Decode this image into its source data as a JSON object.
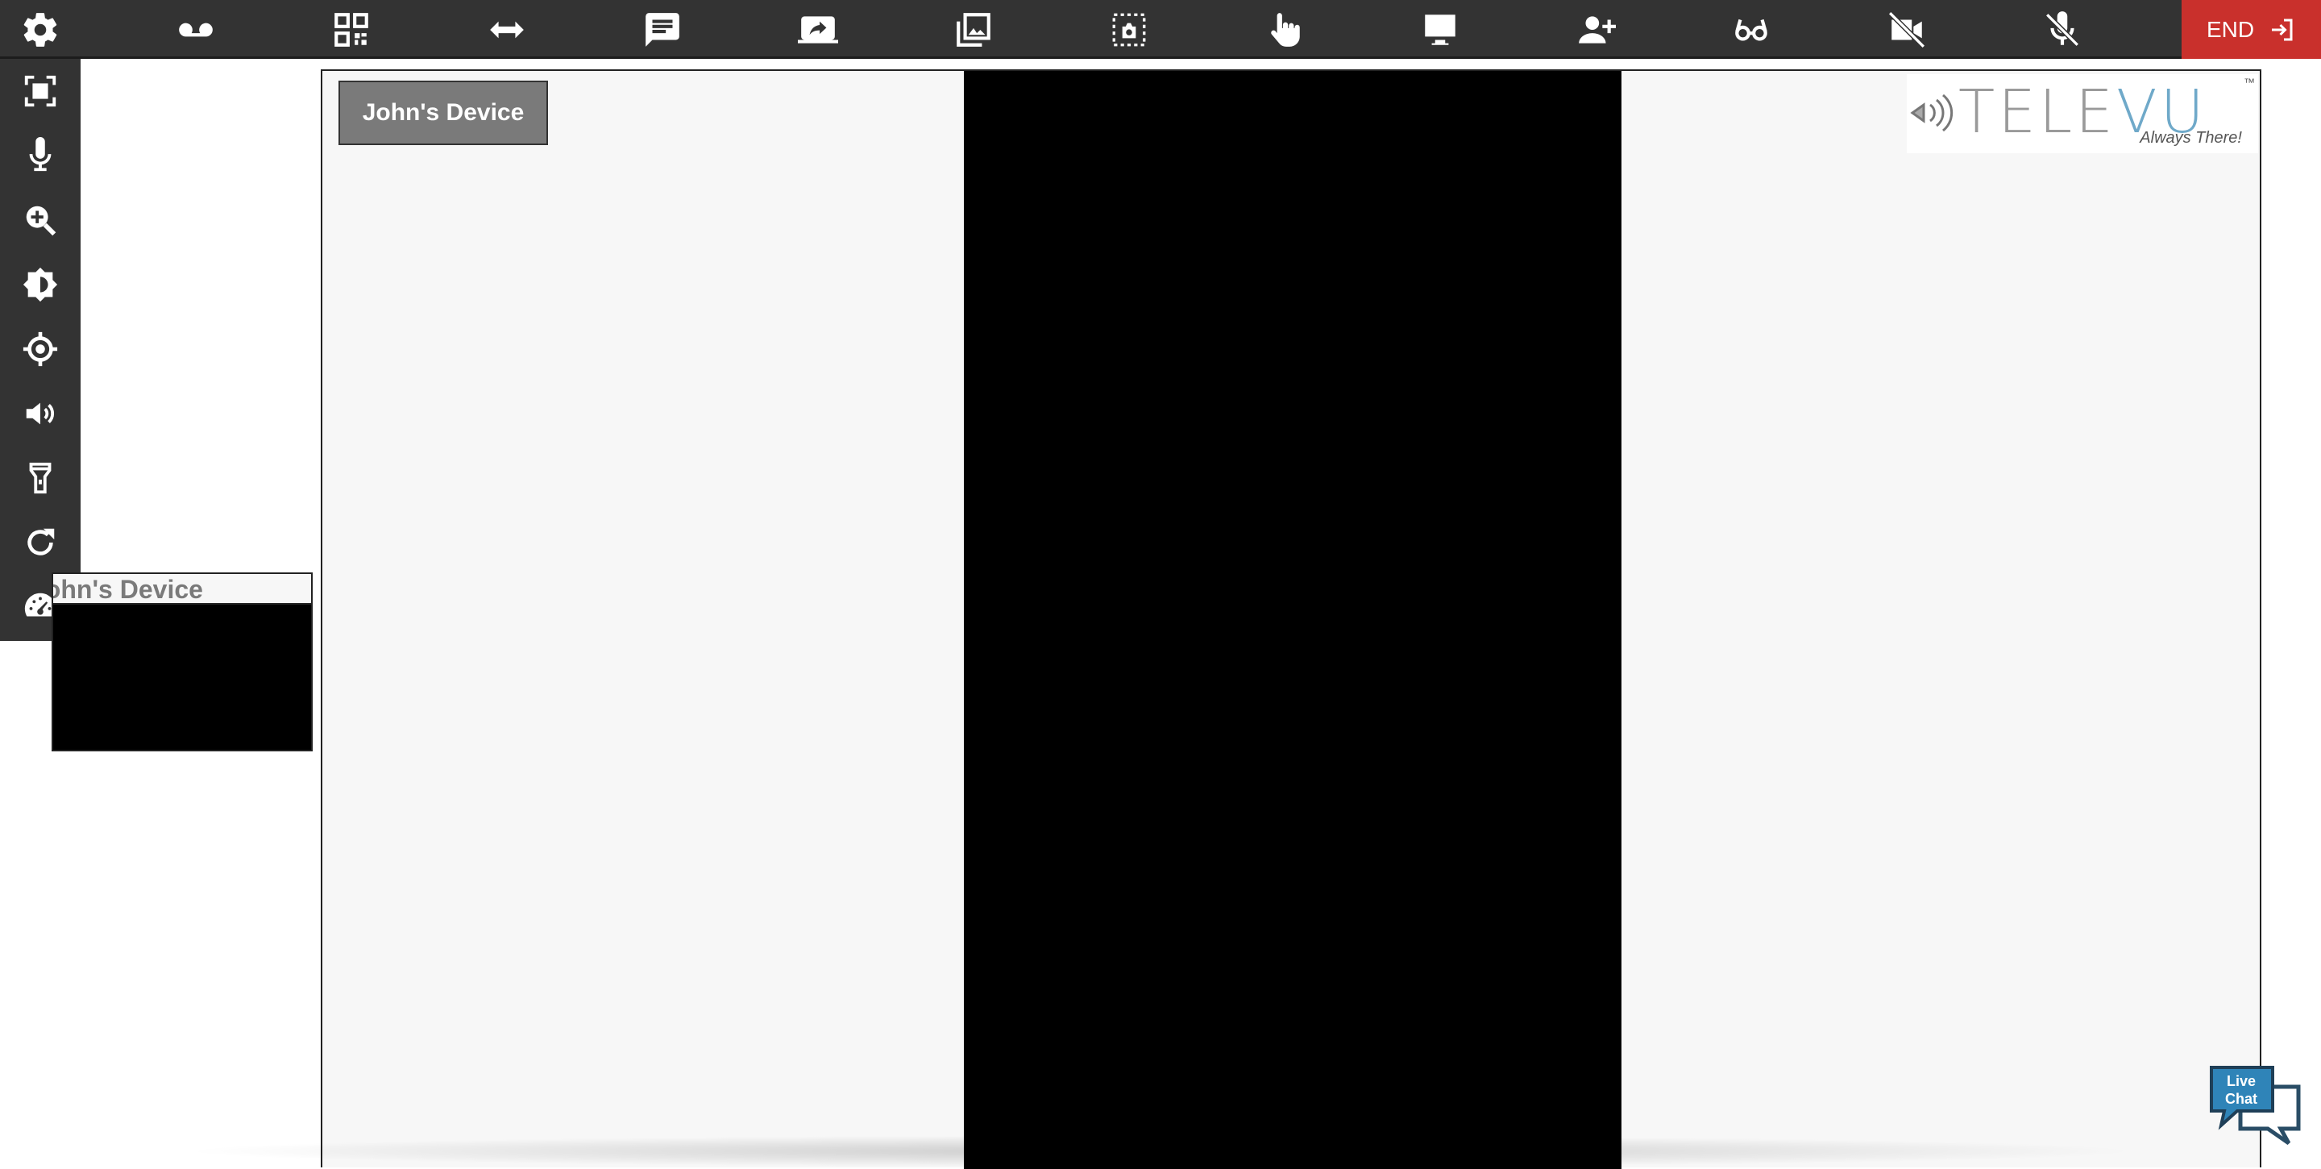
{
  "toolbar": {
    "buttons": [
      {
        "icon": "settings-icon"
      },
      {
        "icon": "voicemail-record-icon"
      },
      {
        "icon": "qr-code-icon"
      },
      {
        "icon": "horizontal-arrows-icon"
      },
      {
        "icon": "chat-icon"
      },
      {
        "icon": "screen-share-icon"
      },
      {
        "icon": "image-gallery-icon"
      },
      {
        "icon": "snapshot-icon"
      },
      {
        "icon": "pointer-hand-icon"
      },
      {
        "icon": "monitor-icon"
      },
      {
        "icon": "add-user-icon"
      },
      {
        "icon": "glasses-icon"
      },
      {
        "icon": "video-off-icon"
      },
      {
        "icon": "mic-off-icon"
      }
    ],
    "end_label": "END"
  },
  "sidebar": {
    "buttons": [
      {
        "icon": "fullscreen-icon"
      },
      {
        "icon": "microphone-icon"
      },
      {
        "icon": "zoom-in-icon"
      },
      {
        "icon": "brightness-icon"
      },
      {
        "icon": "focus-target-icon"
      },
      {
        "icon": "volume-icon"
      },
      {
        "icon": "flashlight-icon"
      },
      {
        "icon": "refresh-icon"
      },
      {
        "icon": "speedometer-icon"
      }
    ]
  },
  "main": {
    "device_label": "John's Device",
    "logo": {
      "brand_left": "TELE",
      "brand_right": "VU",
      "tagline": "Always There!",
      "tm": "™"
    }
  },
  "thumbnail": {
    "label": "John's Device"
  },
  "livechat": {
    "line1": "Live",
    "line2": "Chat"
  },
  "colors": {
    "toolbar": "#333333",
    "end": "#c9302c",
    "stage": "#f7f7f7",
    "brand_blue": "#6fa9c9"
  }
}
